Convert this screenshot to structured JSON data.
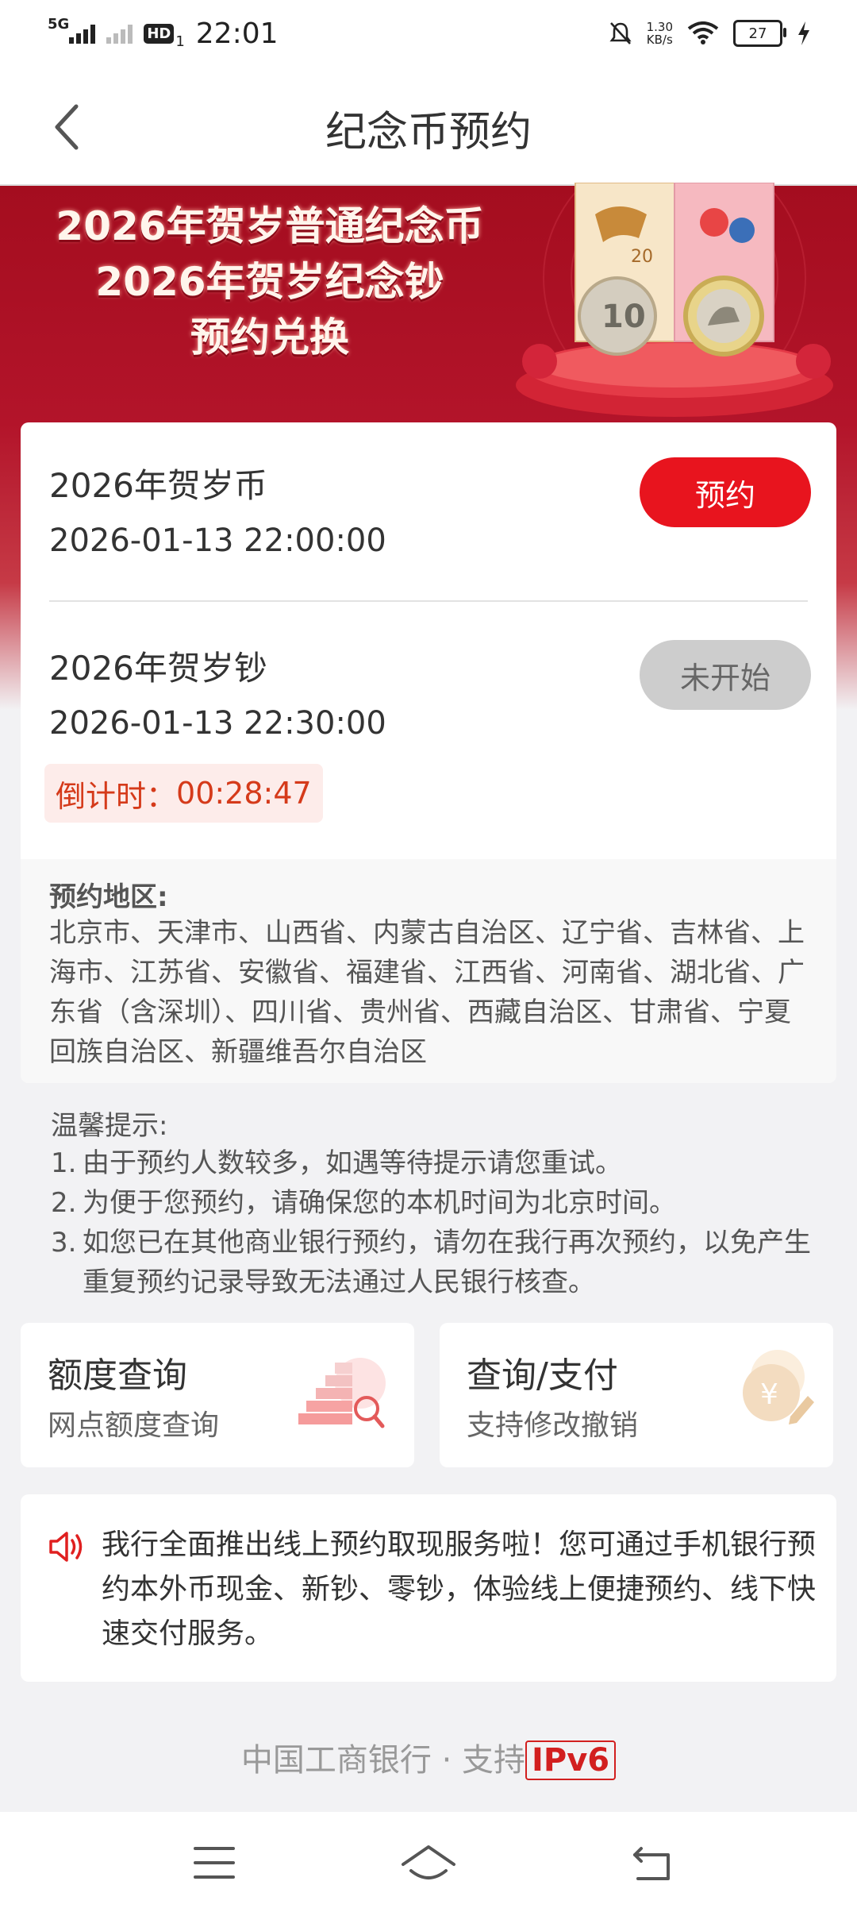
{
  "status_bar": {
    "network_type": "5G",
    "hd_label": "HD",
    "sim_slot": "1",
    "time": "22:01",
    "speed_value": "1.30",
    "speed_unit": "KB/s",
    "battery_level": "27"
  },
  "header": {
    "title": "纪念币预约",
    "back_icon": "chevron-left-icon"
  },
  "banner": {
    "line1": "2026年贺岁普通纪念币",
    "line2": "2026年贺岁纪念钞",
    "line3": "预约兑换",
    "banknote_denomination": "20",
    "coin_denomination": "10"
  },
  "reservations": [
    {
      "title": "2026年贺岁币",
      "datetime": "2026-01-13 22:00:00",
      "button_label": "预约"
    },
    {
      "title": "2026年贺岁钞",
      "datetime": "2026-01-13 22:30:00",
      "button_label": "未开始"
    }
  ],
  "countdown": {
    "label": "倒计时：",
    "value": "00:28:47"
  },
  "region": {
    "label": "预约地区:",
    "text": "北京市、天津市、山西省、内蒙古自治区、辽宁省、吉林省、上海市、江苏省、安徽省、福建省、江西省、河南省、湖北省、广东省（含深圳）、四川省、贵州省、西藏自治区、甘肃省、宁夏回族自治区、新疆维吾尔自治区"
  },
  "tips": {
    "title": "温馨提示:",
    "items": [
      {
        "num": "1.",
        "text": "由于预约人数较多，如遇等待提示请您重试。"
      },
      {
        "num": "2.",
        "text": "为便于您预约，请确保您的本机时间为北京时间。"
      },
      {
        "num": "3.",
        "text": "如您已在其他商业银行预约，请勿在我行再次预约，以免产生重复预约记录导致无法通过人民银行核查。"
      }
    ]
  },
  "shortcuts": [
    {
      "title": "额度查询",
      "subtitle": "网点额度查询",
      "icon": "quota-chart-icon"
    },
    {
      "title": "查询/支付",
      "subtitle": "支持修改撤销",
      "icon": "yuan-coin-pen-icon"
    }
  ],
  "notice": {
    "icon": "speaker-icon",
    "text": "我行全面推出线上预约取现服务啦！您可通过手机银行预约本外币现金、新钞、零钞，体验线上便捷预约、线下快速交付服务。"
  },
  "footer": {
    "text": "中国工商银行 · 支持",
    "badge": "IPv6"
  },
  "colors": {
    "accent_red": "#e8141e",
    "banner_red": "#a40d1f",
    "countdown_text": "#d53a1a"
  }
}
